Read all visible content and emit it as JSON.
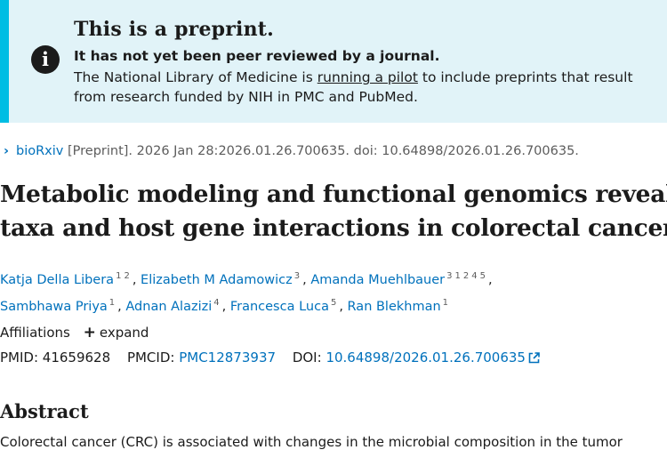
{
  "notice": {
    "heading": "This is a preprint.",
    "bold": "It has not yet been peer reviewed by a journal.",
    "body_before": "The National Library of Medicine is ",
    "link": "running a pilot",
    "body_after": " to include preprints that result from research funded by NIH in PMC and PubMed.",
    "icon": "info-icon"
  },
  "citation": {
    "source": "bioRxiv",
    "rest": "[Preprint]. 2026 Jan 28:2026.01.26.700635. doi: 10.64898/2026.01.26.700635."
  },
  "title_lines": [
    "Metabolic modeling and functional genomics reveal",
    "taxa and host gene interactions in colorectal cancer"
  ],
  "authors": [
    {
      "name": "Katja Della Libera",
      "affs": [
        "1",
        "2"
      ]
    },
    {
      "name": "Elizabeth M Adamowicz",
      "affs": [
        "3"
      ]
    },
    {
      "name": "Amanda Muehlbauer",
      "affs": [
        "3",
        "1",
        "2",
        "4",
        "5"
      ]
    },
    {
      "name": "Sambhawa Priya",
      "affs": [
        "1"
      ]
    },
    {
      "name": "Adnan Alazizi",
      "affs": [
        "4"
      ]
    },
    {
      "name": "Francesca Luca",
      "affs": [
        "5"
      ]
    },
    {
      "name": "Ran Blekhman",
      "affs": [
        "1"
      ]
    }
  ],
  "affiliations": {
    "label": "Affiliations",
    "expand": "expand"
  },
  "ids": {
    "pmid_label": "PMID:",
    "pmid": "41659628",
    "pmcid_label": "PMCID:",
    "pmcid": "PMC12873937",
    "doi_label": "DOI:",
    "doi": "10.64898/2026.01.26.700635"
  },
  "abstract": {
    "heading": "Abstract",
    "text_partial": "Colorectal cancer (CRC) is associated with changes in the microbial composition in the tumor"
  },
  "colors": {
    "link": "#0071bc",
    "notice_bg": "#e1f3f8",
    "notice_border": "#00bde3"
  }
}
